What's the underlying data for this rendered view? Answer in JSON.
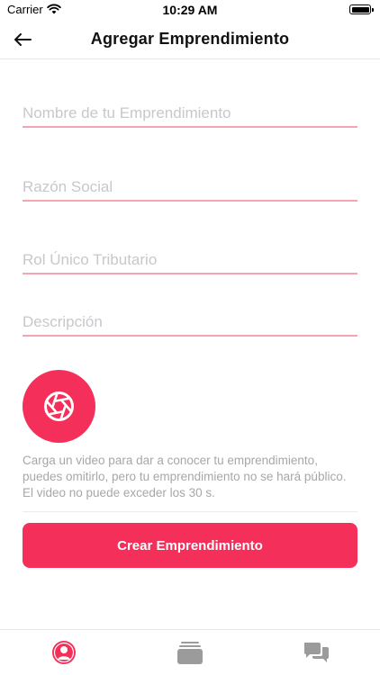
{
  "status_bar": {
    "carrier": "Carrier",
    "time": "10:29 AM"
  },
  "header": {
    "title": "Agregar Emprendimiento"
  },
  "form": {
    "name_placeholder": "Nombre de tu Emprendimiento",
    "business_name_placeholder": "Razón Social",
    "rut_placeholder": "Rol Único Tributario",
    "description_placeholder": "Descripción"
  },
  "video": {
    "helper_text": "Carga un video para dar a conocer tu emprendimiento, puedes omitirlo, pero tu emprendimiento no se hará público. El video no puede exceder los 30 s."
  },
  "actions": {
    "create_label": "Crear Emprendimiento"
  },
  "colors": {
    "accent": "#f4305a",
    "underline": "#f4a6b0",
    "placeholder": "#c8c8cc",
    "helper": "#a7a7aa",
    "tab_inactive": "#9b9b9b"
  },
  "icons": {
    "back": "arrow-left-icon",
    "camera": "camera-aperture-icon",
    "tabs": [
      "profile-icon",
      "cards-stack-icon",
      "chat-bubbles-icon"
    ]
  },
  "tabs": {
    "active_index": 0
  }
}
